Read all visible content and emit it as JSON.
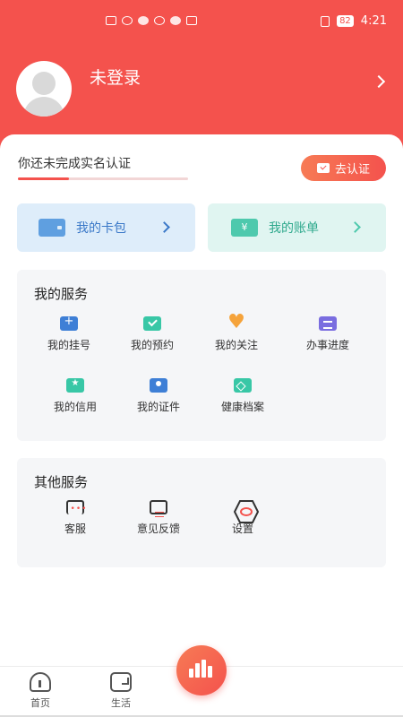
{
  "status_bar": {
    "battery": "82",
    "time": "4:21"
  },
  "profile": {
    "username": "未登录"
  },
  "verification": {
    "prompt": "你还未完成实名认证",
    "progress": 0.3,
    "button_label": "去认证"
  },
  "quick_links": {
    "wallet": "我的卡包",
    "bill": "我的账单",
    "bill_icon_glyph": "¥"
  },
  "my_services": {
    "title": "我的服务",
    "items": [
      {
        "label": "我的挂号",
        "icon": "register-icon"
      },
      {
        "label": "我的预约",
        "icon": "appointment-icon"
      },
      {
        "label": "我的关注",
        "icon": "heart-icon"
      },
      {
        "label": "办事进度",
        "icon": "progress-icon"
      },
      {
        "label": "我的信用",
        "icon": "credit-shield-icon"
      },
      {
        "label": "我的证件",
        "icon": "id-card-icon"
      },
      {
        "label": "健康档案",
        "icon": "health-record-icon"
      }
    ]
  },
  "other_services": {
    "title": "其他服务",
    "items": [
      {
        "label": "客服",
        "icon": "headset-icon"
      },
      {
        "label": "意见反馈",
        "icon": "feedback-icon"
      },
      {
        "label": "设置",
        "icon": "settings-hexagon-icon"
      }
    ]
  },
  "tabbar": {
    "home": "首页",
    "life": "生活"
  },
  "colors": {
    "brand": "#f4524d",
    "wallet_bg": "#deedfa",
    "bill_bg": "#e0f5f1"
  }
}
